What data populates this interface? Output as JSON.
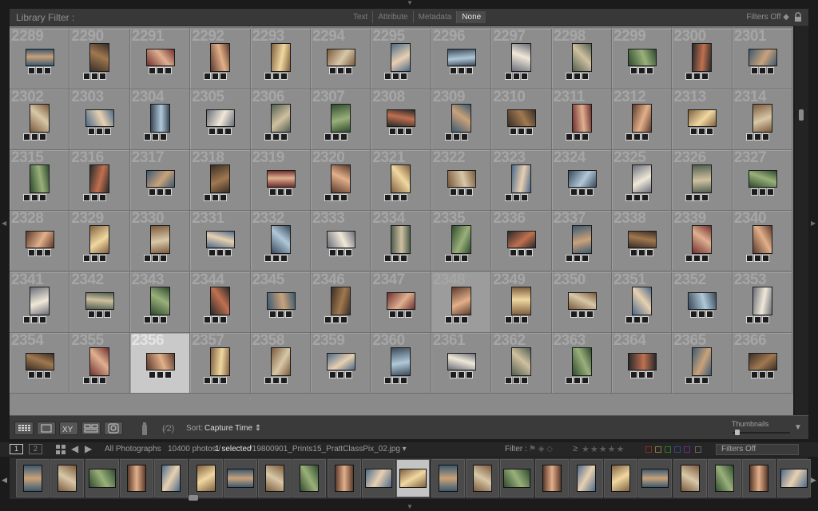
{
  "filter_bar": {
    "title": "Library Filter :",
    "tabs": [
      {
        "label": "Text",
        "active": false
      },
      {
        "label": "Attribute",
        "active": false
      },
      {
        "label": "Metadata",
        "active": false
      },
      {
        "label": "None",
        "active": true
      }
    ],
    "filters_label": "Filters Off ◆"
  },
  "grid": {
    "partial_row": [
      "",
      "",
      "",
      "",
      "",
      "",
      "",
      "",
      "",
      "",
      "",
      "",
      ""
    ],
    "rows": [
      [
        "2289",
        "2290",
        "2291",
        "2292",
        "2293",
        "2294",
        "2295",
        "2296",
        "2297",
        "2298",
        "2299",
        "2300",
        "2301"
      ],
      [
        "2302",
        "2303",
        "2304",
        "2305",
        "2306",
        "2307",
        "2308",
        "2309",
        "2310",
        "2311",
        "2312",
        "2313",
        "2314"
      ],
      [
        "2315",
        "2316",
        "2317",
        "2318",
        "2319",
        "2320",
        "2321",
        "2322",
        "2323",
        "2324",
        "2325",
        "2326",
        "2327"
      ],
      [
        "2328",
        "2329",
        "2330",
        "2331",
        "2332",
        "2333",
        "2334",
        "2335",
        "2336",
        "2337",
        "2338",
        "2339",
        "2340"
      ],
      [
        "2341",
        "2342",
        "2343",
        "2344",
        "2345",
        "2346",
        "2347",
        "2348",
        "2349",
        "2350",
        "2351",
        "2352",
        "2353"
      ],
      [
        "2354",
        "2355",
        "2356",
        "2357",
        "2358",
        "2359",
        "2360",
        "2361",
        "2362",
        "2363",
        "2364",
        "2365",
        "2366"
      ]
    ],
    "selected": "2356",
    "hovered": "2348"
  },
  "toolbar": {
    "sort_label": "Sort:",
    "sort_value": "Capture Time ⇕",
    "thumbnails_label": "Thumbnails",
    "thumbnails_size": 0.05
  },
  "filmstrip_bar": {
    "page1": "1",
    "page2": "2",
    "source": "All Photographs",
    "count": "10400 photos /",
    "selected": "1 selected",
    "path": "/19800901_Prints15_PrattClassPix_02.jpg ▾",
    "filter_label": "Filter :",
    "filters_value": "Filters Off"
  },
  "colors": {
    "grid_bg": "#8d8d8d",
    "selected_cell": "#c9c9c9",
    "panel": "#383838"
  }
}
